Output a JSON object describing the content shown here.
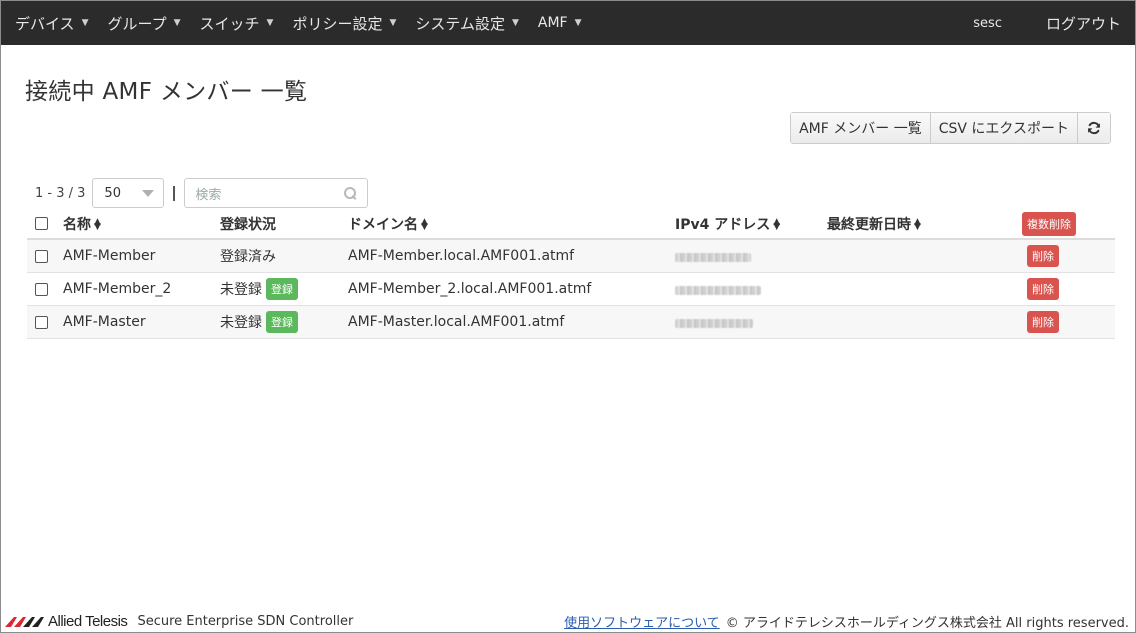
{
  "navbar": {
    "menu": [
      {
        "label": "デバイス"
      },
      {
        "label": "グループ"
      },
      {
        "label": "スイッチ"
      },
      {
        "label": "ポリシー設定"
      },
      {
        "label": "システム設定"
      },
      {
        "label": "AMF"
      }
    ],
    "user": "sesc",
    "logout": "ログアウト"
  },
  "page": {
    "title": "接続中 AMF メンバー 一覧"
  },
  "toolbar": {
    "amf_list_label": "AMF メンバー 一覧",
    "csv_export_label": "CSV にエクスポート",
    "refresh_icon": "refresh-icon"
  },
  "paging": {
    "range": "1 - 3 / 3",
    "page_size": "50",
    "search_placeholder": "検索"
  },
  "table": {
    "columns": {
      "name": "名称",
      "status": "登録状況",
      "domain": "ドメイン名",
      "ip": "IPv4 アドレス",
      "updated": "最終更新日時",
      "bulk_delete": "複数削除"
    },
    "rows": [
      {
        "name": "AMF-Member",
        "status": "登録済み",
        "register_label": "",
        "domain": "AMF-Member.local.AMF001.atmf",
        "ip_blurred": true,
        "updated": "",
        "delete_label": "削除"
      },
      {
        "name": "AMF-Member_2",
        "status": "未登録",
        "register_label": "登録",
        "domain": "AMF-Member_2.local.AMF001.atmf",
        "ip_blurred": true,
        "updated": "",
        "delete_label": "削除"
      },
      {
        "name": "AMF-Master",
        "status": "未登録",
        "register_label": "登録",
        "domain": "AMF-Master.local.AMF001.atmf",
        "ip_blurred": true,
        "updated": "",
        "delete_label": "削除"
      }
    ]
  },
  "footer": {
    "brand": "Allied Telesis",
    "product": "Secure Enterprise SDN Controller",
    "software_link": "使用ソフトウェアについて",
    "copyright": "© アライドテレシスホールディングス株式会社 All rights reserved.",
    "brand_color": "#d9282f"
  },
  "colors": {
    "navbar": "#2b2b2b",
    "success": "#5cb85c",
    "danger": "#d9534f"
  }
}
